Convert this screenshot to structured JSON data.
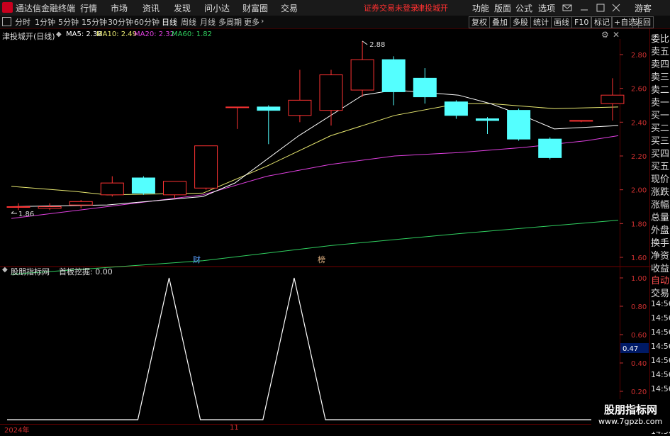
{
  "app": {
    "title": "通达信金融终端",
    "menus": [
      "行情",
      "市场",
      "资讯",
      "发现",
      "问小达",
      "财富圈",
      "交易"
    ],
    "warning": "证券交易未登录",
    "stock": "津投城开",
    "right_menus": [
      "功能",
      "版面",
      "公式",
      "选项"
    ],
    "guest": "游客"
  },
  "toolbar": {
    "periods": [
      "分时",
      "1分钟",
      "5分钟",
      "15分钟",
      "30分钟",
      "60分钟",
      "日线",
      "周线",
      "月线",
      "多周期",
      "更多"
    ],
    "active_period": "日线",
    "right_buttons": [
      "复权",
      "叠加",
      "多股",
      "统计",
      "画线",
      "F10",
      "标记",
      "+自选",
      "返回"
    ]
  },
  "main_chart": {
    "title": "津投城开(日线)",
    "ma": [
      {
        "label": "MA5: 2.38",
        "color": "#ffffff"
      },
      {
        "label": "MA10: 2.49",
        "color": "#e8e870"
      },
      {
        "label": "MA20: 2.32",
        "color": "#e040e0"
      },
      {
        "label": "MA60: 1.82",
        "color": "#30d060"
      }
    ],
    "high_label": "2.88",
    "low_label": "1.86",
    "y_ticks": [
      "2.80",
      "2.60",
      "2.40",
      "2.20",
      "2.00",
      "1.80",
      "1.60"
    ],
    "marker_cai": "财",
    "marker_bang": "榜",
    "up_color": "#ff3333",
    "down_color": "#54ffff",
    "candles": [
      {
        "o": 1.9,
        "h": 1.92,
        "l": 1.88,
        "c": 1.9
      },
      {
        "o": 1.89,
        "h": 1.92,
        "l": 1.88,
        "c": 1.9
      },
      {
        "o": 1.91,
        "h": 1.94,
        "l": 1.89,
        "c": 1.93
      },
      {
        "o": 1.97,
        "h": 2.08,
        "l": 1.96,
        "c": 2.04
      },
      {
        "o": 2.07,
        "h": 2.08,
        "l": 1.97,
        "c": 1.98
      },
      {
        "o": 1.97,
        "h": 2.05,
        "l": 1.95,
        "c": 2.05
      },
      {
        "o": 2.01,
        "h": 2.26,
        "l": 2.0,
        "c": 2.26
      },
      {
        "o": 2.49,
        "h": 2.49,
        "l": 2.36,
        "c": 2.49
      },
      {
        "o": 2.49,
        "h": 2.5,
        "l": 2.27,
        "c": 2.47
      },
      {
        "o": 2.44,
        "h": 2.71,
        "l": 2.4,
        "c": 2.53
      },
      {
        "o": 2.47,
        "h": 2.71,
        "l": 2.38,
        "c": 2.68
      },
      {
        "o": 2.59,
        "h": 2.88,
        "l": 2.55,
        "c": 2.77
      },
      {
        "o": 2.77,
        "h": 2.79,
        "l": 2.5,
        "c": 2.58
      },
      {
        "o": 2.66,
        "h": 2.72,
        "l": 2.51,
        "c": 2.55
      },
      {
        "o": 2.52,
        "h": 2.53,
        "l": 2.42,
        "c": 2.44
      },
      {
        "o": 2.42,
        "h": 2.43,
        "l": 2.33,
        "c": 2.41
      },
      {
        "o": 2.47,
        "h": 2.48,
        "l": 2.29,
        "c": 2.3
      },
      {
        "o": 2.3,
        "h": 2.31,
        "l": 2.18,
        "c": 2.19
      },
      {
        "o": 2.41,
        "h": 2.41,
        "l": 2.4,
        "c": 2.41
      },
      {
        "o": 2.51,
        "h": 2.66,
        "l": 2.41,
        "c": 2.56
      }
    ],
    "ma_lines": {
      "ma5": [
        [
          0,
          1.9
        ],
        [
          3,
          1.91
        ],
        [
          6,
          1.96
        ],
        [
          7,
          2.04
        ],
        [
          9,
          2.32
        ],
        [
          11,
          2.56
        ],
        [
          12,
          2.59
        ],
        [
          14,
          2.56
        ],
        [
          15,
          2.51
        ],
        [
          16,
          2.44
        ],
        [
          17,
          2.36
        ],
        [
          19,
          2.38
        ]
      ],
      "ma10": [
        [
          0,
          2.02
        ],
        [
          2,
          1.99
        ],
        [
          3,
          1.97
        ],
        [
          6,
          1.98
        ],
        [
          8,
          2.14
        ],
        [
          10,
          2.32
        ],
        [
          12,
          2.44
        ],
        [
          14,
          2.51
        ],
        [
          15,
          2.51
        ],
        [
          17,
          2.48
        ],
        [
          19,
          2.49
        ]
      ],
      "ma20": [
        [
          0,
          1.83
        ],
        [
          3,
          1.9
        ],
        [
          6,
          1.97
        ],
        [
          8,
          2.08
        ],
        [
          10,
          2.15
        ],
        [
          12,
          2.2
        ],
        [
          14,
          2.22
        ],
        [
          16,
          2.25
        ],
        [
          18,
          2.29
        ],
        [
          19,
          2.32
        ]
      ],
      "ma60": [
        [
          0,
          1.5
        ],
        [
          6,
          1.58
        ],
        [
          10,
          1.67
        ],
        [
          14,
          1.74
        ],
        [
          19,
          1.82
        ]
      ]
    }
  },
  "sub_chart": {
    "title": "股朋指标网",
    "indicator": "首板挖掘: 0.00",
    "y_ticks": [
      "1.00",
      "0.80",
      "0.60",
      "0.40",
      "0.20"
    ],
    "cursor_value": "0.47",
    "values": [
      0,
      0,
      0,
      0,
      0,
      1,
      0,
      0,
      0,
      1,
      0,
      0,
      0,
      0,
      0,
      0,
      0,
      0,
      0,
      0
    ]
  },
  "x_axis": {
    "labels": [
      "2024年",
      "11"
    ]
  },
  "right_panel": {
    "items": [
      "委比",
      "卖五",
      "卖四",
      "卖三",
      "卖二",
      "卖一",
      "买一",
      "买二",
      "买三",
      "买四",
      "买五",
      "现价",
      "涨跌",
      "涨幅",
      "总量",
      "外盘",
      "换手",
      "净资",
      "收益"
    ],
    "auto_label": "自动",
    "trade_label": "交易",
    "times": [
      "14:56",
      "14:56",
      "14:56",
      "14:56",
      "14:56",
      "14:56",
      "14:56",
      "14:56",
      "14:56",
      "14:56"
    ]
  },
  "watermark": {
    "line1": "股朋指标网",
    "line2": "www.7gpzb.com"
  }
}
